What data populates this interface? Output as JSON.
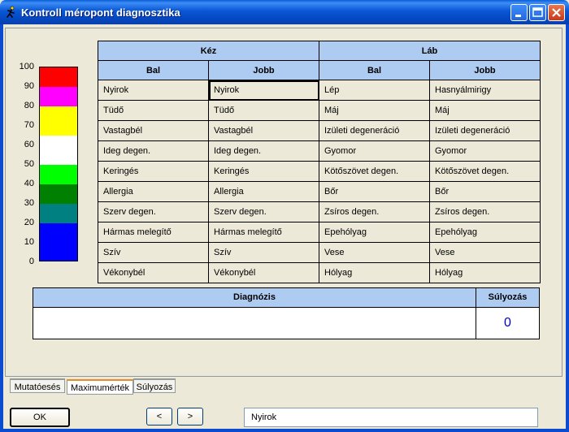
{
  "window": {
    "title": "Kontroll méropont diagnosztika"
  },
  "scale": {
    "labels": [
      "100",
      "90",
      "80",
      "70",
      "60",
      "50",
      "40",
      "30",
      "20",
      "10",
      "0"
    ],
    "bands": [
      {
        "color": "#ff0000"
      },
      {
        "color": "#ff00ff"
      },
      {
        "color": "#ffff00"
      },
      {
        "color": "#ffffff"
      },
      {
        "color": "#00ff00"
      },
      {
        "color": "#008000"
      },
      {
        "color": "#008080"
      },
      {
        "color": "#0000ff"
      }
    ]
  },
  "table": {
    "groups": [
      "Kéz",
      "Láb"
    ],
    "subheaders": [
      "Bal",
      "Jobb",
      "Bal",
      "Jobb"
    ],
    "rows": [
      [
        "Nyirok",
        "Nyirok",
        "Lép",
        "Hasnyálmirigy"
      ],
      [
        "Tüdő",
        "Tüdő",
        "Máj",
        "Máj"
      ],
      [
        "Vastagbél",
        "Vastagbél",
        "Izületi degeneráció",
        "Izületi degeneráció"
      ],
      [
        "Ideg degen.",
        "Ideg degen.",
        "Gyomor",
        "Gyomor"
      ],
      [
        "Keringés",
        "Keringés",
        "Kötőszövet degen.",
        "Kötőszövet degen."
      ],
      [
        "Allergia",
        "Allergia",
        "Bőr",
        "Bőr"
      ],
      [
        "Szerv degen.",
        "Szerv degen.",
        "Zsíros degen.",
        "Zsíros degen."
      ],
      [
        "Hármas melegítő",
        "Hármas melegítő",
        "Epehólyag",
        "Epehólyag"
      ],
      [
        "Szív",
        "Szív",
        "Vese",
        "Vese"
      ],
      [
        "Vékonybél",
        "Vékonybél",
        "Hólyag",
        "Hólyag"
      ]
    ]
  },
  "diagnosis": {
    "header": "Diagnózis",
    "value": ""
  },
  "weighting": {
    "header": "Súlyozás",
    "value": "0",
    "color": "#0000cc"
  },
  "tabs": [
    "Mutatóesés",
    "Maximumérték",
    "Súlyozás"
  ],
  "buttons": {
    "ok": "OK",
    "prev": "<",
    "next": ">"
  },
  "status": {
    "text": "Nyirok"
  }
}
